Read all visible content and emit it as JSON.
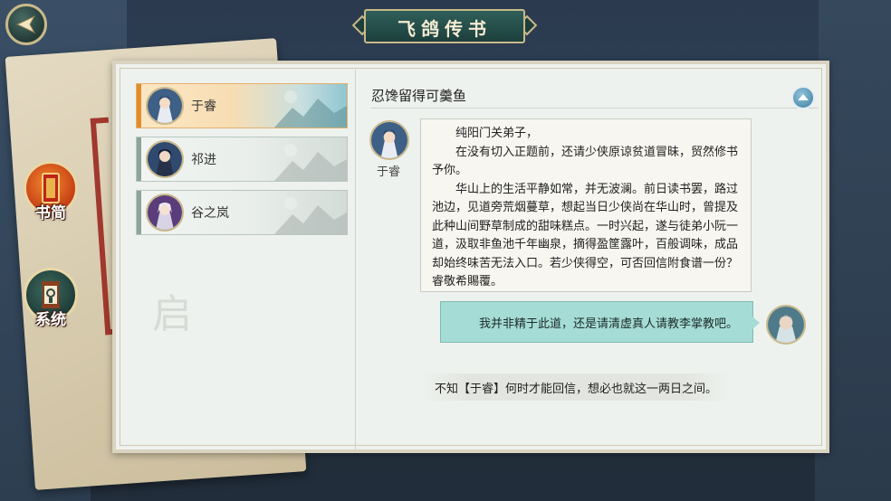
{
  "title": "飞鸽传书",
  "sidebar": {
    "buttons": [
      {
        "label": "书简",
        "icon": "letter-scroll-icon"
      },
      {
        "label": "系统",
        "icon": "lantern-icon"
      }
    ]
  },
  "contacts": [
    {
      "name": "于睿",
      "active": true
    },
    {
      "name": "祁进",
      "active": false
    },
    {
      "name": "谷之岚",
      "active": false
    }
  ],
  "watermark": "启",
  "conversation": {
    "subject": "忍馋留得可羹鱼",
    "sender": "于睿",
    "letter_paragraphs": [
      "纯阳门关弟子，",
      "在没有切入正题前，还请少侠原谅贫道冒昧，贸然修书予你。",
      "华山上的生活平静如常，并无波澜。前日读书罢，路过池边，见道旁荒烟蔓草，想起当日少侠尚在华山时，曾提及此种山间野草制成的甜味糕点。一时兴起，遂与徒弟小阮一道，汲取非鱼池千年幽泉，摘得盈筐露叶，百般调味，成品却始终味苦无法入口。若少侠得空，可否回信附食谱一份？睿敬希賜覆。"
    ],
    "reply": "我并非精于此道，还是请清虚真人请教李掌教吧。",
    "status_note": "不知【于睿】何时才能回信，想必也就这一两日之间。"
  }
}
